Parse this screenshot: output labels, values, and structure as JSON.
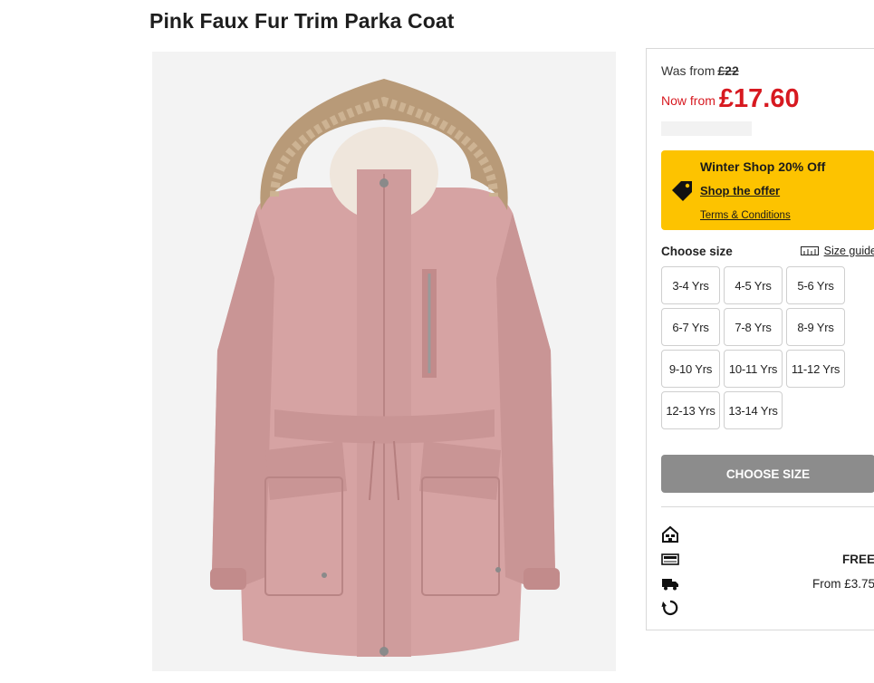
{
  "product": {
    "title": "Pink Faux Fur Trim Parka Coat"
  },
  "pricing": {
    "was_label": "Was from",
    "was_price": "£22",
    "now_label": "Now from",
    "now_price": "£17.60"
  },
  "offer": {
    "title": "Winter Shop 20% Off",
    "link": "Shop the offer",
    "terms": "Terms & Conditions",
    "icon": "price-tag-icon",
    "background": "#fdc300"
  },
  "sizes": {
    "label": "Choose size",
    "guide_label": "Size guide",
    "options": [
      "3-4 Yrs",
      "4-5 Yrs",
      "5-6 Yrs",
      "6-7 Yrs",
      "7-8 Yrs",
      "8-9 Yrs",
      "9-10 Yrs",
      "10-11 Yrs",
      "11-12 Yrs",
      "12-13 Yrs",
      "13-14 Yrs"
    ]
  },
  "cta": {
    "label": "CHOOSE SIZE"
  },
  "delivery": {
    "rows": [
      {
        "icon": "store-icon",
        "value": ""
      },
      {
        "icon": "click-collect-icon",
        "value": "FREE"
      },
      {
        "icon": "truck-icon",
        "value": "From £3.75"
      },
      {
        "icon": "returns-icon",
        "value": ""
      }
    ]
  },
  "colors": {
    "sale_red": "#d71920",
    "button_grey": "#8c8c8c",
    "coat_pink": "#d6a3a3"
  }
}
